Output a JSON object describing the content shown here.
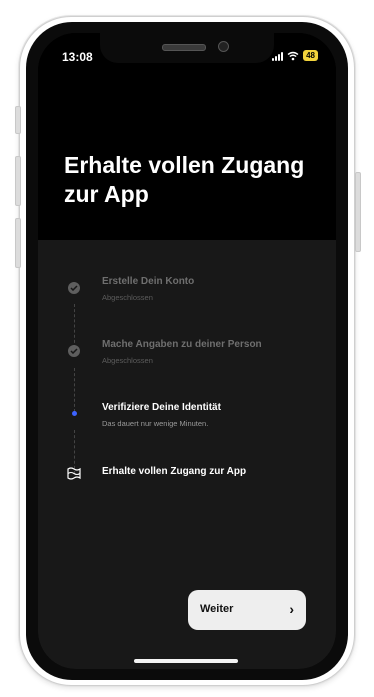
{
  "status_bar": {
    "time": "13:08",
    "battery": "48"
  },
  "header": {
    "title": "Erhalte vollen Zugang zur App"
  },
  "steps": [
    {
      "title": "Erstelle Dein Konto",
      "subtitle": "Abgeschlossen",
      "state": "done",
      "icon": "check-circle-icon"
    },
    {
      "title": "Mache Angaben zu deiner Person",
      "subtitle": "Abgeschlossen",
      "state": "done",
      "icon": "check-circle-icon"
    },
    {
      "title": "Verifiziere Deine Identität",
      "subtitle": "Das dauert nur wenige Minuten.",
      "state": "active",
      "icon": "current-step-dot-icon"
    },
    {
      "title": "Erhalte vollen Zugang zur App",
      "subtitle": "",
      "state": "pending",
      "icon": "flag-icon"
    }
  ],
  "footer": {
    "continue_label": "Weiter",
    "continue_icon": "chevron-right-icon"
  },
  "colors": {
    "background": "#000000",
    "steps_background": "#181818",
    "accent_dot": "#3d63ff",
    "button_bg": "#eeeeee",
    "battery": "#f2d33c"
  }
}
